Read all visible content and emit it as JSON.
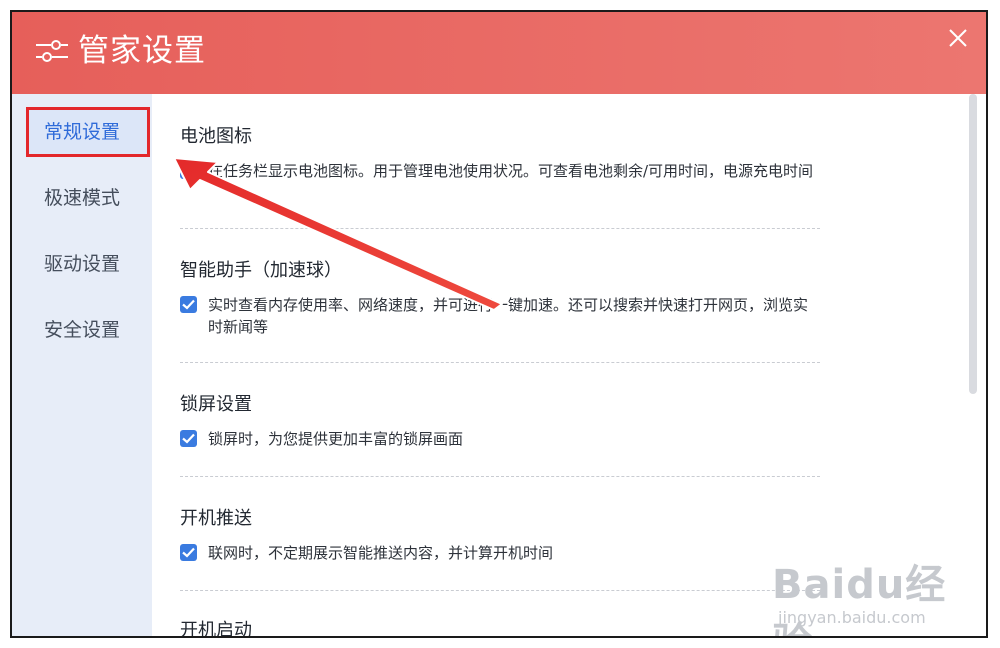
{
  "window": {
    "title": "管家设置",
    "title_icon": "settings-sliders-icon",
    "close_icon": "close-icon"
  },
  "sidebar": {
    "items": [
      {
        "label": "常规设置",
        "active": true
      },
      {
        "label": "极速模式",
        "active": false
      },
      {
        "label": "驱动设置",
        "active": false
      },
      {
        "label": "安全设置",
        "active": false
      }
    ]
  },
  "sections": [
    {
      "title": "电池图标",
      "option": {
        "checked": false,
        "text": "在任务栏显示电池图标。用于管理电池使用状况。可查看电池剩余/可用时间，电源充电时间"
      }
    },
    {
      "title": "智能助手（加速球）",
      "option": {
        "checked": true,
        "text": "实时查看内存使用率、网络速度，并可进行一键加速。还可以搜索并快速打开网页，浏览实时新闻等"
      }
    },
    {
      "title": "锁屏设置",
      "option": {
        "checked": true,
        "text": "锁屏时，为您提供更加丰富的锁屏画面"
      }
    },
    {
      "title": "开机推送",
      "option": {
        "checked": true,
        "text": "联网时，不定期展示智能推送内容，并计算开机时间"
      }
    },
    {
      "title": "开机启动"
    }
  ],
  "watermark": {
    "logo": "Baidu经验",
    "url": "jingyan.baidu.com"
  },
  "colors": {
    "title_bar": "#e8655f",
    "sidebar_bg": "#e7edf8",
    "accent": "#3a7be0",
    "annotation": "#e3272b"
  }
}
